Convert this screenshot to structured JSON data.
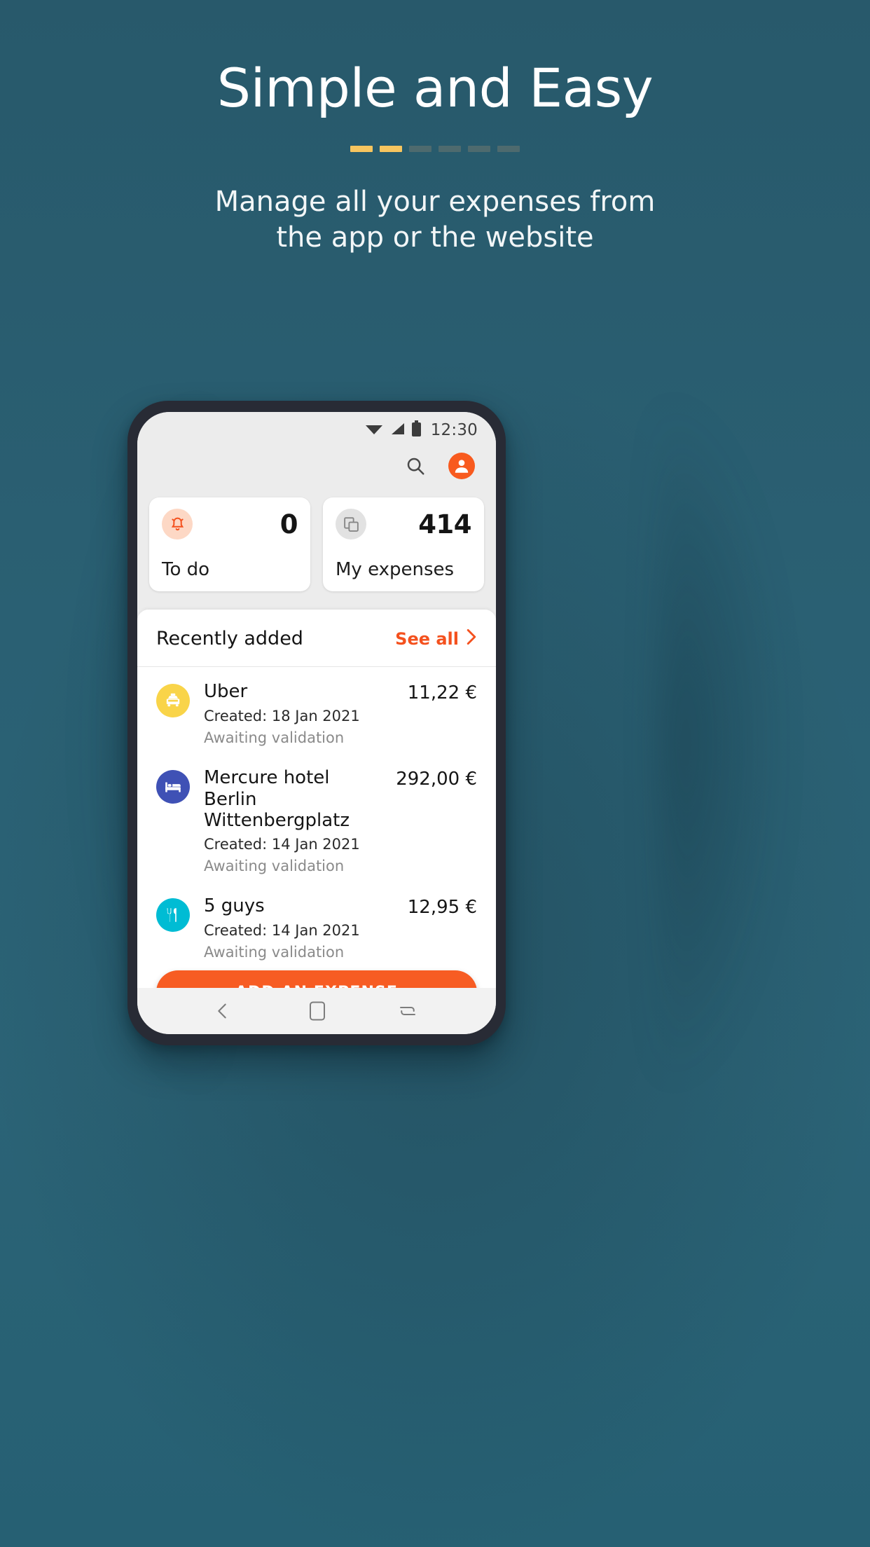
{
  "hero": {
    "title": "Simple and Easy",
    "subtitle_line1": "Manage all your expenses from",
    "subtitle_line2": "the app or the website",
    "progress": {
      "total": 6,
      "active": 2,
      "active_color": "#f7c55f",
      "inactive_color": "#4e6a6e"
    }
  },
  "phone": {
    "statusbar": {
      "time": "12:30",
      "icons": [
        "wifi-icon",
        "cellular-signal-icon",
        "battery-icon"
      ]
    },
    "appbar": {
      "search_label": "search-icon",
      "avatar_label": "account-avatar"
    },
    "cards": [
      {
        "icon": "bell-icon",
        "value": "0",
        "label": "To do",
        "icon_bg": "#fdd8c5",
        "icon_color": "#f4511e"
      },
      {
        "icon": "copy-layers-icon",
        "value": "414",
        "label": "My expenses",
        "icon_bg": "#e2e2e2",
        "icon_color": "#8a8a8a"
      }
    ],
    "sheet": {
      "title": "Recently added",
      "see_all": "See all",
      "items": [
        {
          "icon": "taxi-icon",
          "icon_bg": "#f9d449",
          "title": "Uber",
          "created": "Created: 18 Jan 2021",
          "status": "Awaiting validation",
          "amount": "11,22 €"
        },
        {
          "icon": "hotel-bed-icon",
          "icon_bg": "#3f51b5",
          "title": "Mercure hotel Berlin Wittenbergplatz",
          "created": "Created: 14 Jan 2021",
          "status": "Awaiting validation",
          "amount": "292,00 €"
        },
        {
          "icon": "restaurant-icon",
          "icon_bg": "#00bcd4",
          "title": "5 guys",
          "created": "Created: 14 Jan 2021",
          "status": "Awaiting validation",
          "amount": "12,95 €"
        }
      ]
    },
    "cta_label": "ADD AN EXPENSE",
    "navbar": {
      "back": "back-arrow-icon",
      "home": "home-square-icon",
      "recents": "recents-icon"
    }
  },
  "colors": {
    "background_teal": "#265b6e",
    "accent_orange": "#f75c23",
    "accent_gold": "#f7c55f"
  }
}
